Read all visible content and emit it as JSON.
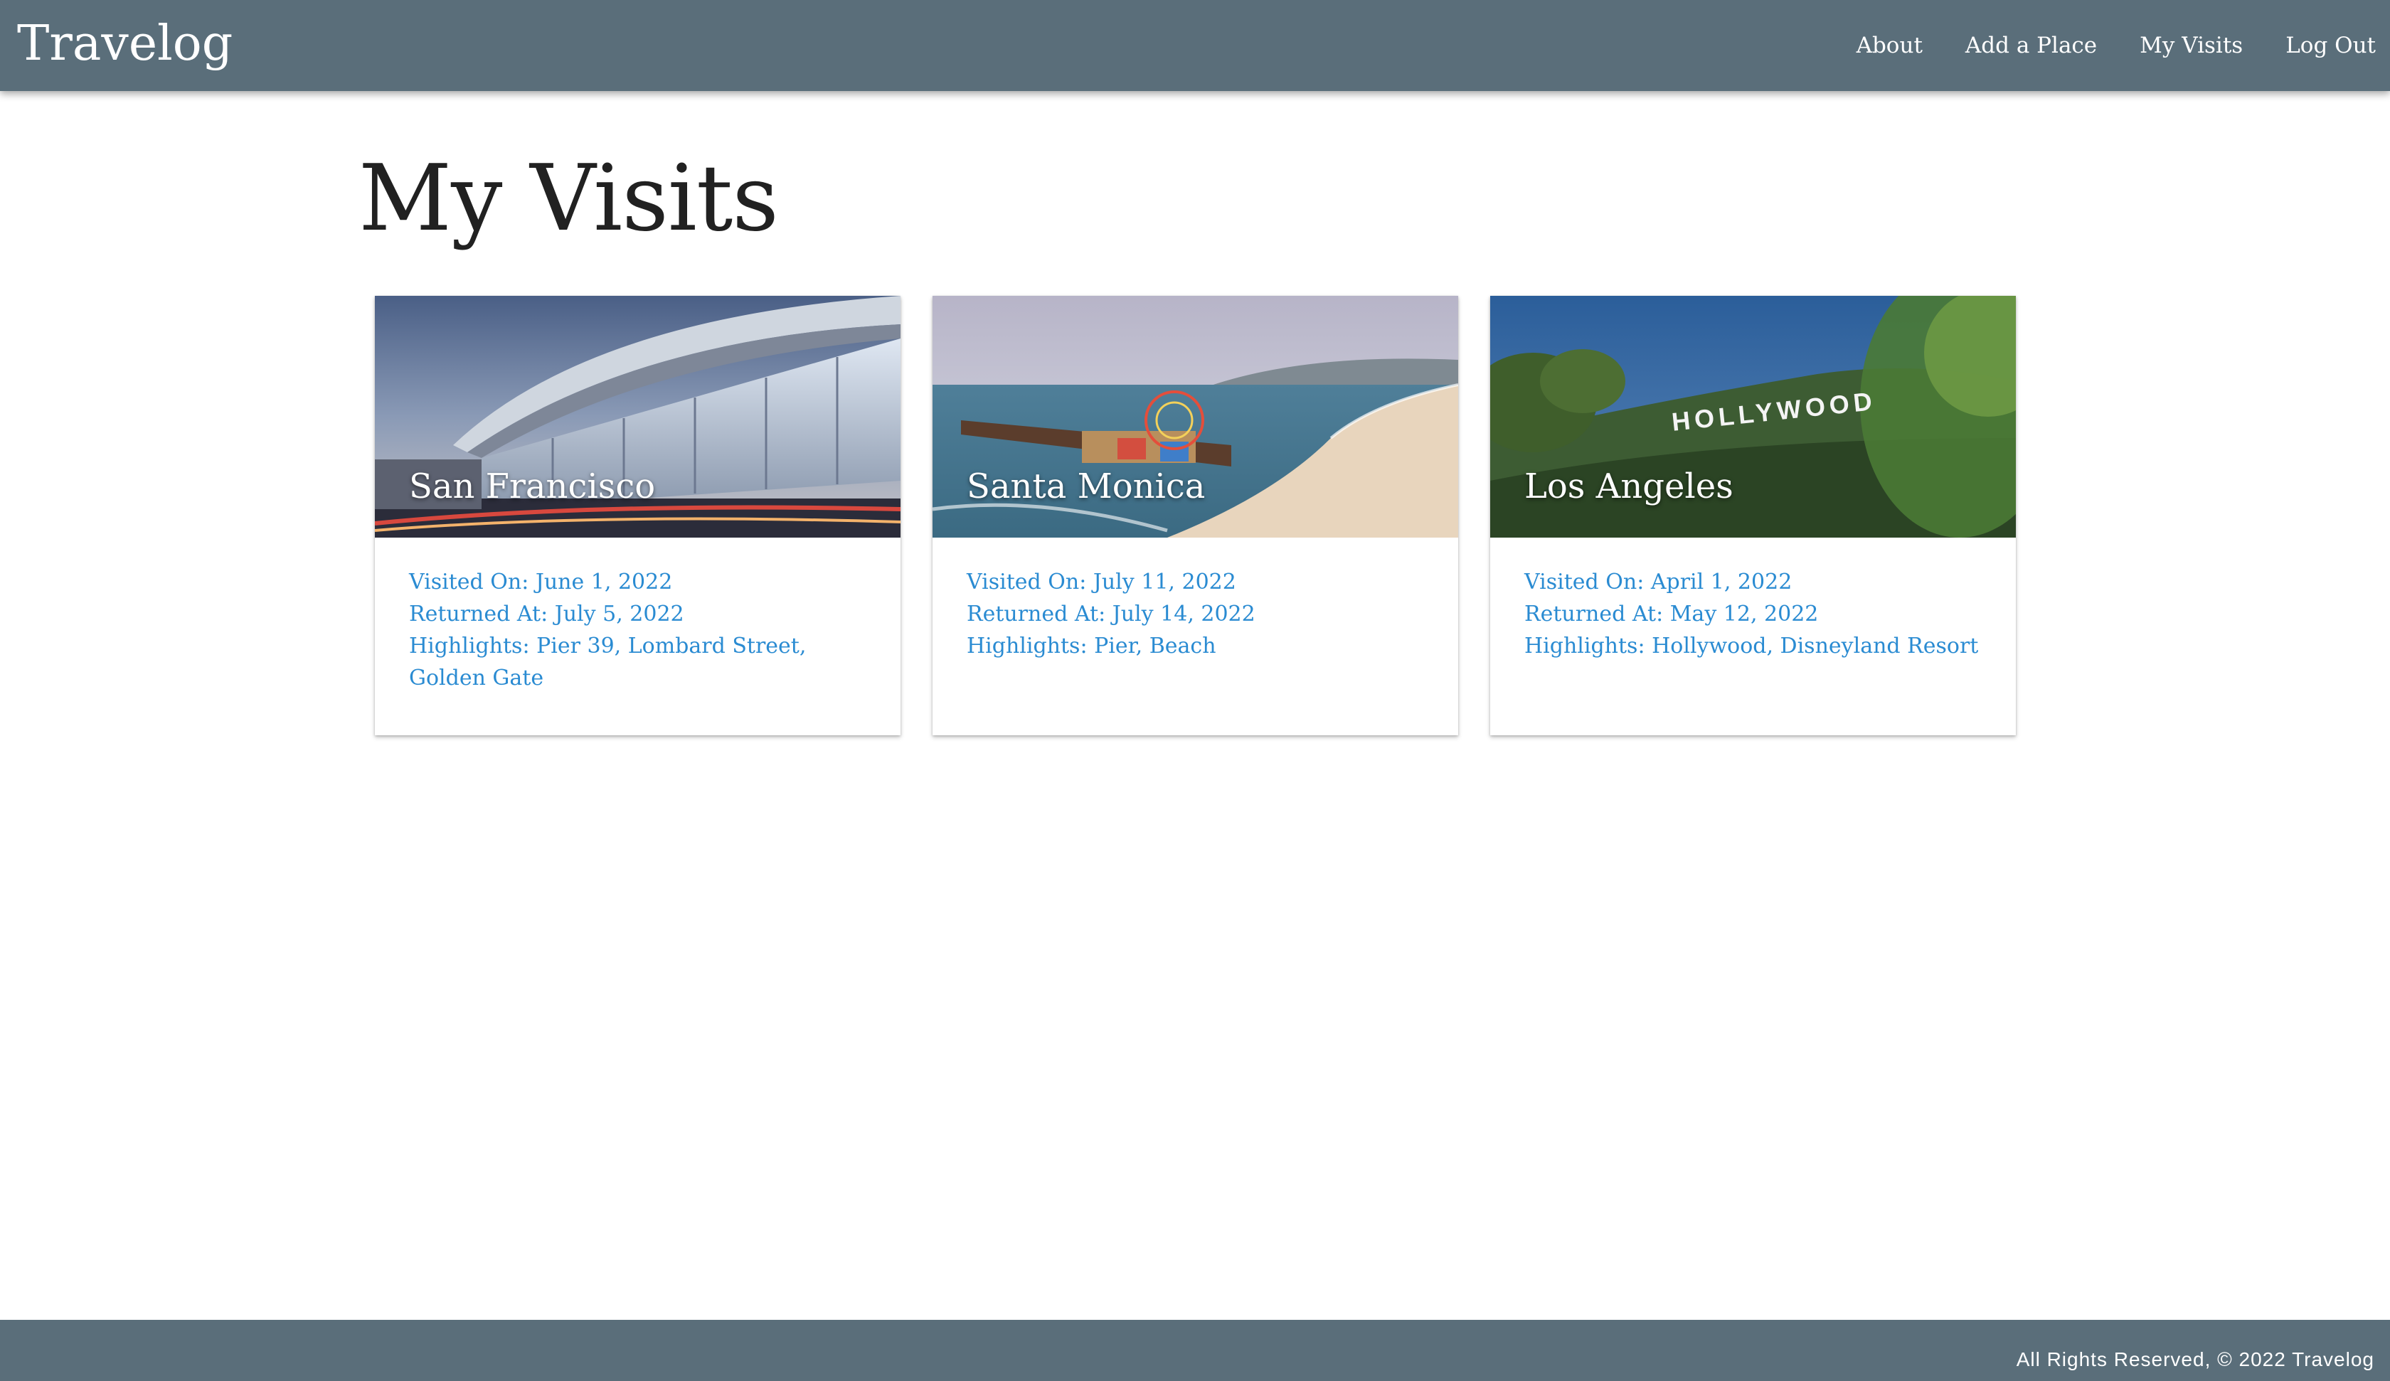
{
  "navbar": {
    "brand": "Travelog",
    "links": [
      "About",
      "Add a Place",
      "My Visits",
      "Log Out"
    ]
  },
  "page": {
    "title": "My Visits"
  },
  "visits": [
    {
      "title": "San Francisco",
      "image": "airport-terminal-photo",
      "visited_on": "Visited On: June 1, 2022",
      "returned_at": "Returned At: July 5, 2022",
      "highlights": "Highlights: Pier 39, Lombard Street, Golden Gate"
    },
    {
      "title": "Santa Monica",
      "image": "pier-beach-photo",
      "visited_on": "Visited On: July 11, 2022",
      "returned_at": "Returned At: July 14, 2022",
      "highlights": "Highlights: Pier, Beach"
    },
    {
      "title": "Los Angeles",
      "image": "hollywood-sign-photo",
      "sign_text": "HOLLYWOOD",
      "visited_on": "Visited On: April 1, 2022",
      "returned_at": "Returned At: May 12, 2022",
      "highlights": "Highlights: Hollywood, Disneyland Resort"
    }
  ],
  "footer": {
    "text": "All Rights Reserved, © 2022 Travelog"
  },
  "colors": {
    "navbar": "#5a6e7a",
    "link": "#2a8bd2",
    "title": "#212121"
  }
}
